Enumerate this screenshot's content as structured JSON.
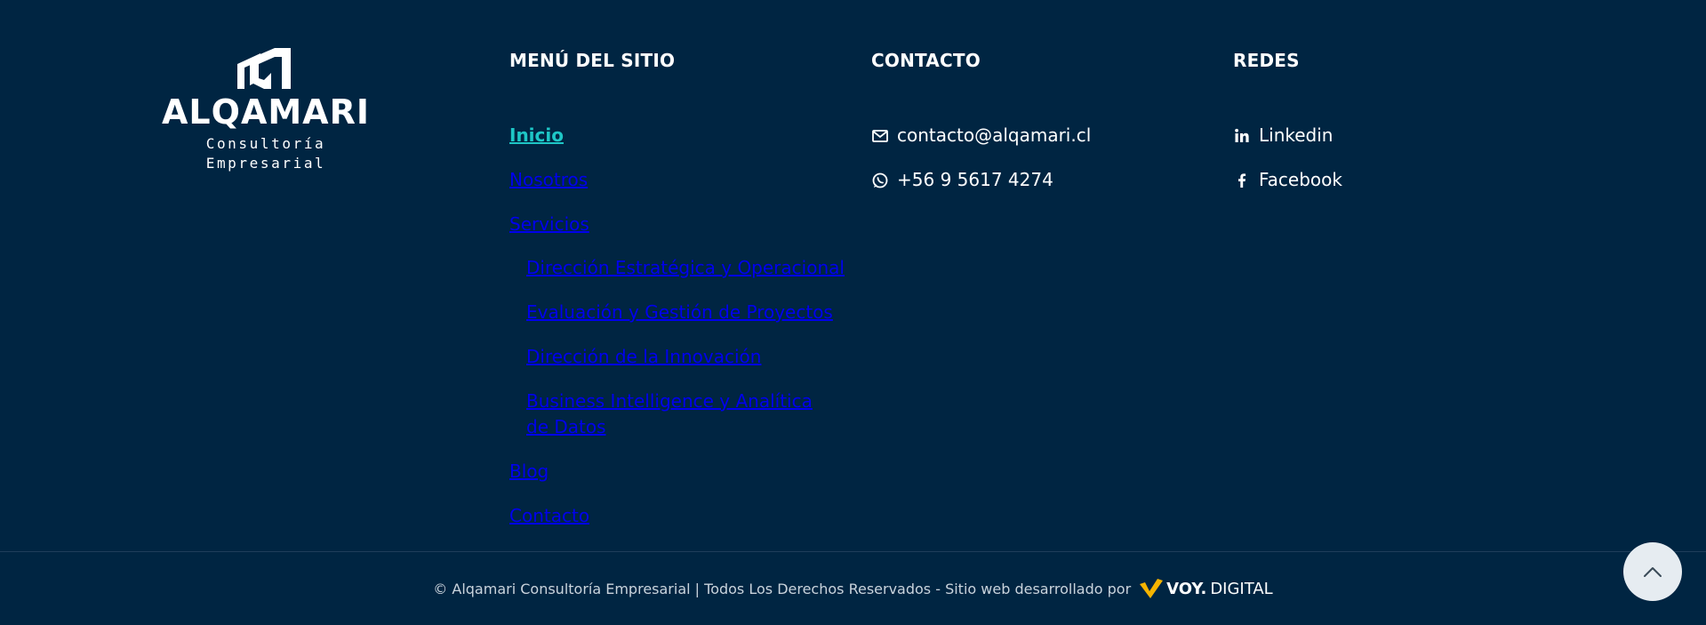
{
  "brand": {
    "name": "ALQAMARI",
    "tagline": "Consultoría Empresarial"
  },
  "menu": {
    "title": "MENÚ DEL SITIO",
    "items": [
      {
        "label": "Inicio"
      },
      {
        "label": "Nosotros"
      },
      {
        "label": "Servicios"
      },
      {
        "label": "Dirección Estratégica y Operacional"
      },
      {
        "label": "Evaluación y Gestión de Proyectos"
      },
      {
        "label": "Dirección de la Innovación"
      },
      {
        "label": "Business Intelligence y Analítica de Datos"
      },
      {
        "label": "Blog"
      },
      {
        "label": "Contacto"
      }
    ]
  },
  "contact": {
    "title": "CONTACTO",
    "email": "contacto@alqamari.cl",
    "phone": "+56 9 5617 4274",
    "icons": [
      "mail-icon",
      "whatsapp-icon"
    ]
  },
  "social": {
    "title": "REDES",
    "items": [
      {
        "label": "Linkedin",
        "icon": "linkedin-icon"
      },
      {
        "label": "Facebook",
        "icon": "facebook-icon"
      }
    ]
  },
  "footer": {
    "copyright": "© Alqamari Consultoría Empresarial | Todos Los Derechos Reservados - Sitio web desarrollado por",
    "dev_bold": "VOY.",
    "dev_rest": "DIGITAL"
  },
  "colors": {
    "background": "#002542",
    "accent": "#1ec6c6",
    "dev_mark": "#f5b400"
  },
  "back_to_top_icon": "chevron-up-icon"
}
